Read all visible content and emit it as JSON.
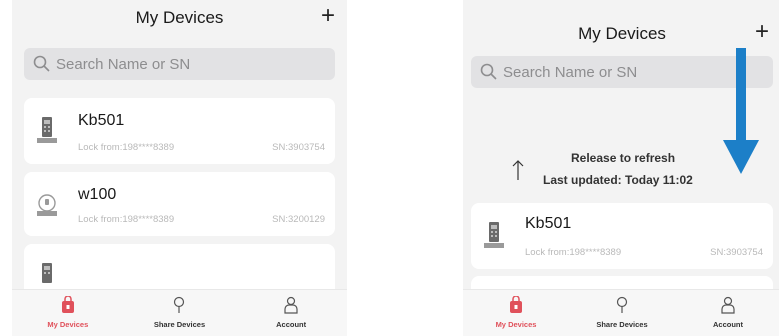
{
  "left": {
    "title": "My Devices",
    "add_label": "+",
    "search_placeholder": "Search Name or SN",
    "devices": [
      {
        "name": "Kb501",
        "lock_from": "Lock from:198****8389",
        "sn": "SN:3903754",
        "icon": "keypad-lock-icon"
      },
      {
        "name": "w100",
        "lock_from": "Lock from:198****8389",
        "sn": "SN:3200129",
        "icon": "round-lock-icon"
      },
      {
        "name": "",
        "lock_from": "",
        "sn": "",
        "icon": "keypad-lock-icon"
      }
    ]
  },
  "right": {
    "title": "My Devices",
    "add_label": "+",
    "search_placeholder": "Search Name or SN",
    "refresh_text": "Release to refresh",
    "last_updated": "Last updated: Today 11:02",
    "devices": [
      {
        "name": "Kb501",
        "lock_from": "Lock from:198****8389",
        "sn": "SN:3903754",
        "icon": "keypad-lock-icon"
      }
    ]
  },
  "tabs": [
    {
      "label": "My Devices",
      "icon": "lock-bag-icon",
      "active": true
    },
    {
      "label": "Share Devices",
      "icon": "pin-icon",
      "active": false
    },
    {
      "label": "Account",
      "icon": "person-icon",
      "active": false
    }
  ],
  "colors": {
    "accent": "#e0515b",
    "arrow_blue": "#1c7fc8",
    "background": "#f3f3f3"
  }
}
